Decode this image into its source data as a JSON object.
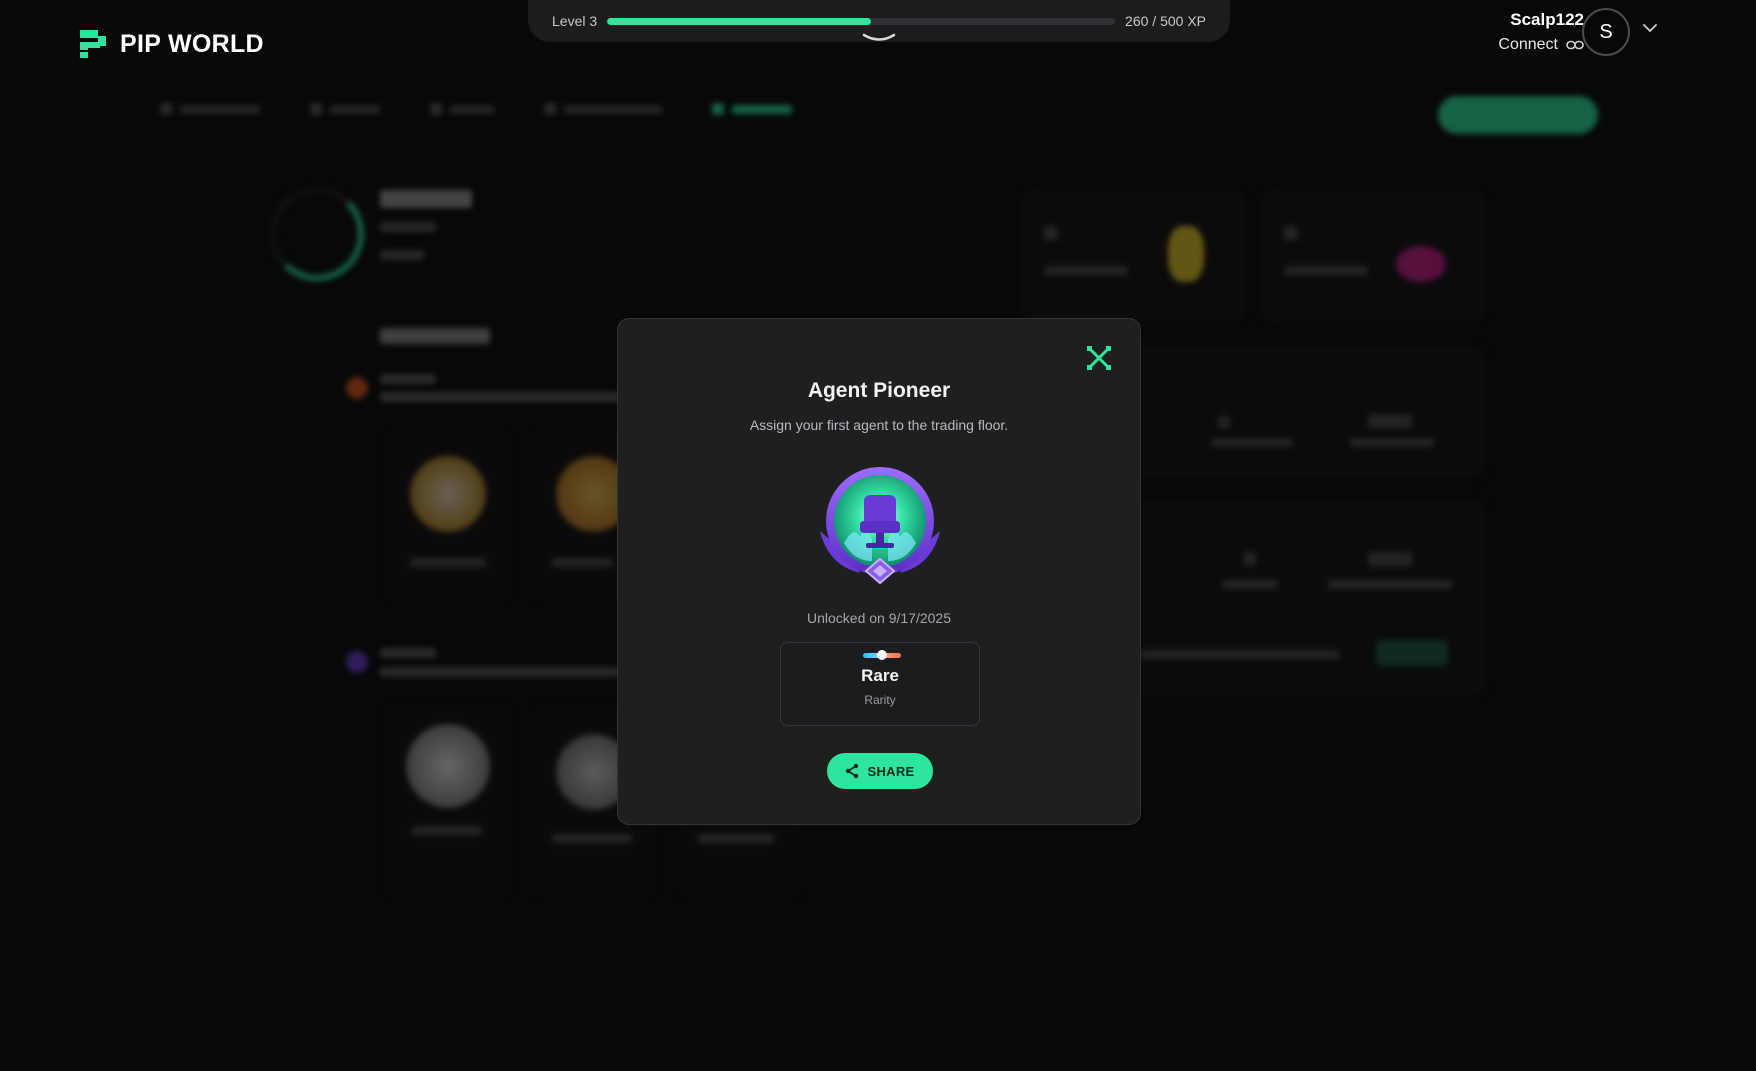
{
  "brand": {
    "name": "PIP WORLD",
    "accent": "#2ee59d"
  },
  "xp": {
    "level_label": "Level 3",
    "current": 260,
    "max": 500,
    "progress": 0.52,
    "count_label": "260 / 500 XP"
  },
  "user": {
    "name": "Scalp122",
    "connect_label": "Connect",
    "avatar_initial": "S"
  },
  "modal": {
    "title": "Agent Pioneer",
    "description": "Assign your first agent to the trading floor.",
    "badge_icon": "agent-chair-badge",
    "unlocked": "Unlocked on 9/17/2025",
    "rarity": {
      "value": "Rare",
      "label": "Rarity"
    },
    "share_label": "SHARE"
  },
  "icons": {
    "close": "close-icon",
    "share": "share-icon",
    "link": "link-icon",
    "chevron": "chevron-down-icon"
  }
}
